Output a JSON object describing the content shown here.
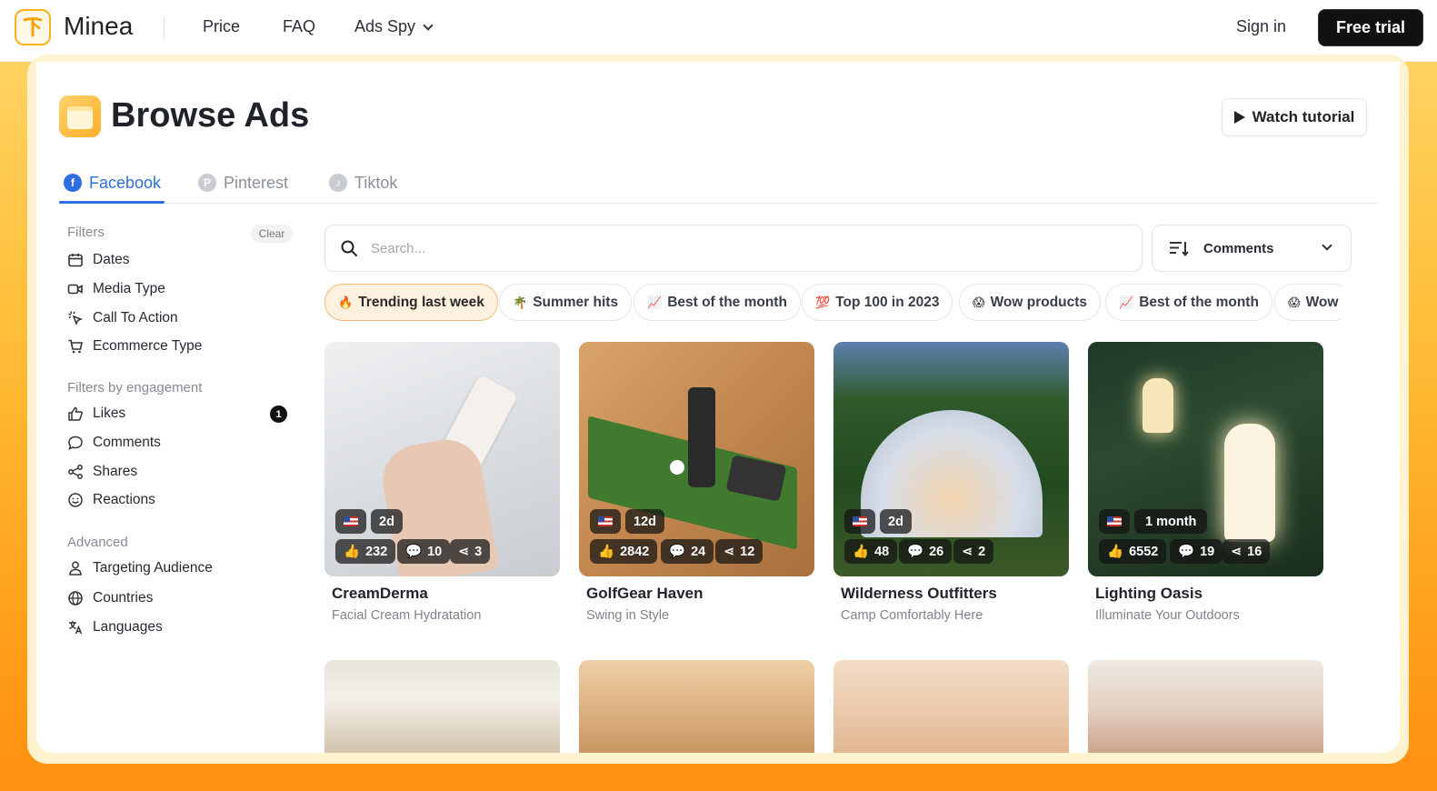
{
  "nav": {
    "brand": "Minea",
    "links": [
      "Price",
      "FAQ",
      "Ads Spy"
    ],
    "sign_in": "Sign in",
    "free_trial": "Free trial"
  },
  "page": {
    "title": "Browse Ads",
    "watch_tutorial": "Watch tutorial"
  },
  "tabs": [
    {
      "label": "Facebook",
      "icon": "facebook-icon",
      "active": true
    },
    {
      "label": "Pinterest",
      "icon": "pinterest-icon",
      "active": false
    },
    {
      "label": "Tiktok",
      "icon": "tiktok-icon",
      "active": false
    }
  ],
  "sidebar": {
    "filters_heading": "Filters",
    "clear": "Clear",
    "filters": [
      "Dates",
      "Media Type",
      "Call To Action",
      "Ecommerce Type"
    ],
    "engagement_heading": "Filters by engagement",
    "engagement": [
      "Likes",
      "Comments",
      "Shares",
      "Reactions"
    ],
    "likes_count": "1",
    "advanced_heading": "Advanced",
    "advanced": [
      "Targeting Audience",
      "Countries",
      "Languages"
    ]
  },
  "search": {
    "placeholder": "Search...",
    "value": ""
  },
  "sort": {
    "selected": "Comments"
  },
  "chips": [
    {
      "emoji": "🔥",
      "label": "Trending last week",
      "active": true
    },
    {
      "emoji": "🌴",
      "label": "Summer hits",
      "active": false
    },
    {
      "emoji": "📈",
      "label": "Best of the month",
      "active": false
    },
    {
      "emoji": "💯",
      "label": "Top 100 in 2023",
      "active": false
    },
    {
      "emoji": "😱",
      "label": "Wow products",
      "active": false
    },
    {
      "emoji": "📈",
      "label": "Best of the month",
      "active": false
    },
    {
      "emoji": "😱",
      "label": "Wow",
      "active": false
    }
  ],
  "cards": [
    {
      "name": "CreamDerma",
      "subtitle": "Facial Cream Hydratation",
      "age": "2d",
      "likes": "232",
      "comments": "10",
      "shares": "3"
    },
    {
      "name": "GolfGear Haven",
      "subtitle": "Swing in Style",
      "age": "12d",
      "likes": "2842",
      "comments": "24",
      "shares": "12"
    },
    {
      "name": "Wilderness Outfitters",
      "subtitle": "Camp Comfortably Here",
      "age": "2d",
      "likes": "48",
      "comments": "26",
      "shares": "2"
    },
    {
      "name": "Lighting Oasis",
      "subtitle": "Illuminate Your Outdoors",
      "age": "1 month",
      "likes": "6552",
      "comments": "19",
      "shares": "16"
    }
  ],
  "colors": {
    "accent": "#2f6de1",
    "brand_orange": "#f7b21e",
    "active_chip_bg": "#fff1df"
  }
}
